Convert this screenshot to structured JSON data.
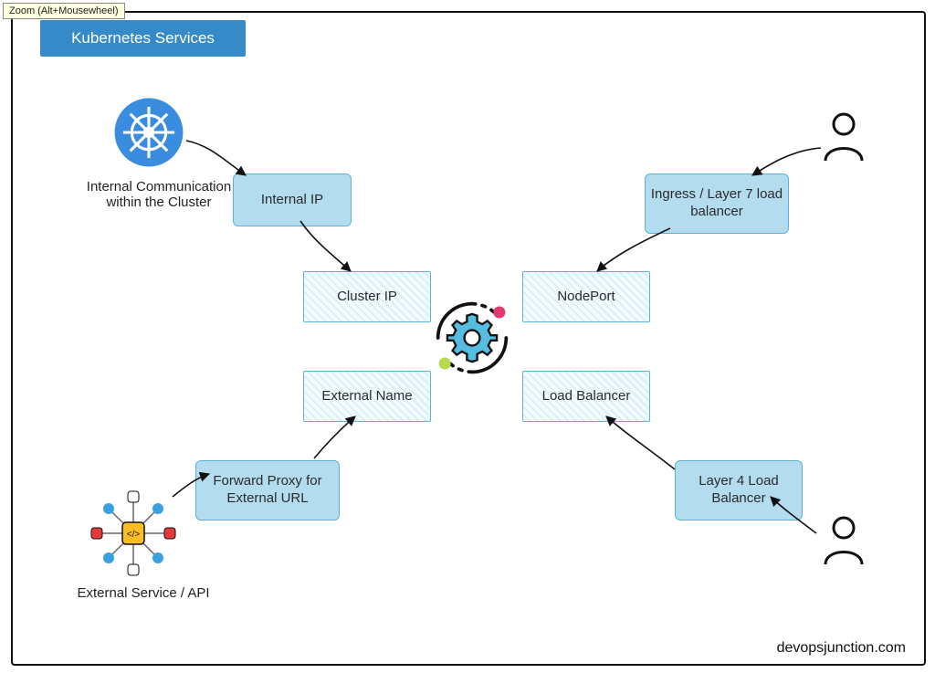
{
  "tooltip": "Zoom (Alt+Mousewheel)",
  "title": "Kubernetes Services",
  "boxes": {
    "internal_ip": "Internal IP",
    "ingress_l7": "Ingress / Layer 7 load balancer",
    "cluster_ip": "Cluster IP",
    "nodeport": "NodePort",
    "external_name": "External Name",
    "load_balancer": "Load Balancer",
    "forward_proxy": "Forward Proxy for External URL",
    "l4_lb": "Layer 4 Load Balancer"
  },
  "captions": {
    "internal_comm": "Internal Communication within the Cluster",
    "external_api": "External Service / API"
  },
  "attribution": "devopsjunction.com",
  "icons": {
    "k8s": "kubernetes-wheel-icon",
    "user_top": "user-icon",
    "user_bottom": "user-icon",
    "api": "api-mesh-icon",
    "gear": "gear-orbit-icon"
  }
}
